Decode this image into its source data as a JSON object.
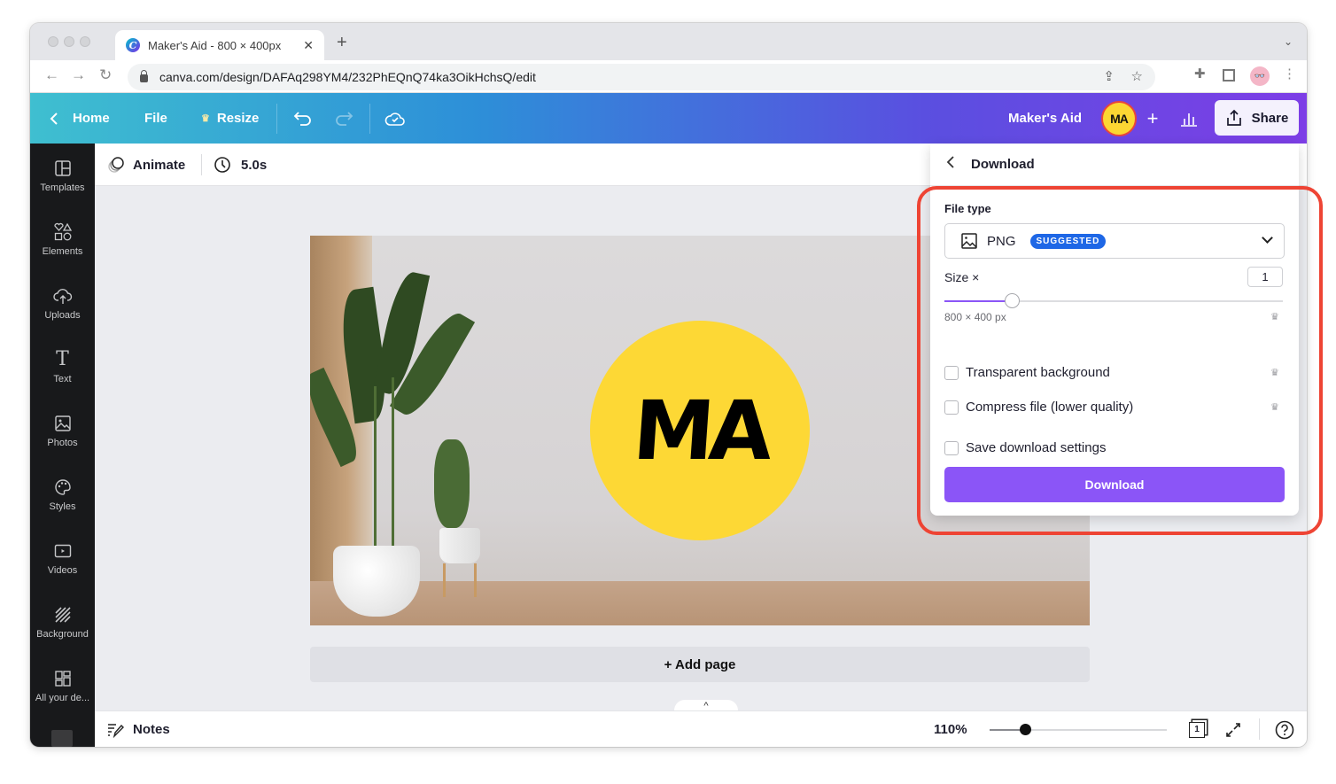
{
  "browser": {
    "tab_title": "Maker's Aid - 800 × 400px",
    "tab_close": "✕",
    "new_tab": "+",
    "url": "canva.com/design/DAFAq298YM4/232PhEQnQ74ka3OikHchsQ/edit",
    "favicon_letter": "C",
    "profile_glyph": "👓"
  },
  "header": {
    "home_label": "Home",
    "file_label": "File",
    "resize_label": "Resize",
    "design_title": "Maker's Aid",
    "avatar_initials": "MA",
    "share_label": "Share"
  },
  "sidebar": {
    "items": [
      {
        "label": "Templates"
      },
      {
        "label": "Elements"
      },
      {
        "label": "Uploads"
      },
      {
        "label": "Text"
      },
      {
        "label": "Photos"
      },
      {
        "label": "Styles"
      },
      {
        "label": "Videos"
      },
      {
        "label": "Background"
      },
      {
        "label": "All your de..."
      }
    ]
  },
  "context_bar": {
    "animate_label": "Animate",
    "duration": "5.0s"
  },
  "canvas": {
    "logo_text": "MA",
    "logo_color": "#fdd835",
    "add_page_label": "+ Add page",
    "show_notes_glyph": "^"
  },
  "bottom_bar": {
    "notes_label": "Notes",
    "zoom_level": "110%",
    "zoom_slider_fraction": 0.2,
    "page_count": "1"
  },
  "download_panel": {
    "title": "Download",
    "file_type_label": "File type",
    "file_type_value": "PNG",
    "file_type_badge": "SUGGESTED",
    "size_label": "Size ×",
    "size_value": "1",
    "size_slider_fraction": 0.2,
    "dimensions": "800 × 400 px",
    "options": [
      {
        "label": "Transparent background",
        "checked": false,
        "premium": true
      },
      {
        "label": "Compress file (lower quality)",
        "checked": false,
        "premium": true
      },
      {
        "label": "Save download settings",
        "checked": false,
        "premium": false
      }
    ],
    "download_button_label": "Download",
    "accent_color": "#8b55f7",
    "badge_color": "#1e67e6"
  },
  "annotation": {
    "highlight_color": "#ee4434"
  }
}
